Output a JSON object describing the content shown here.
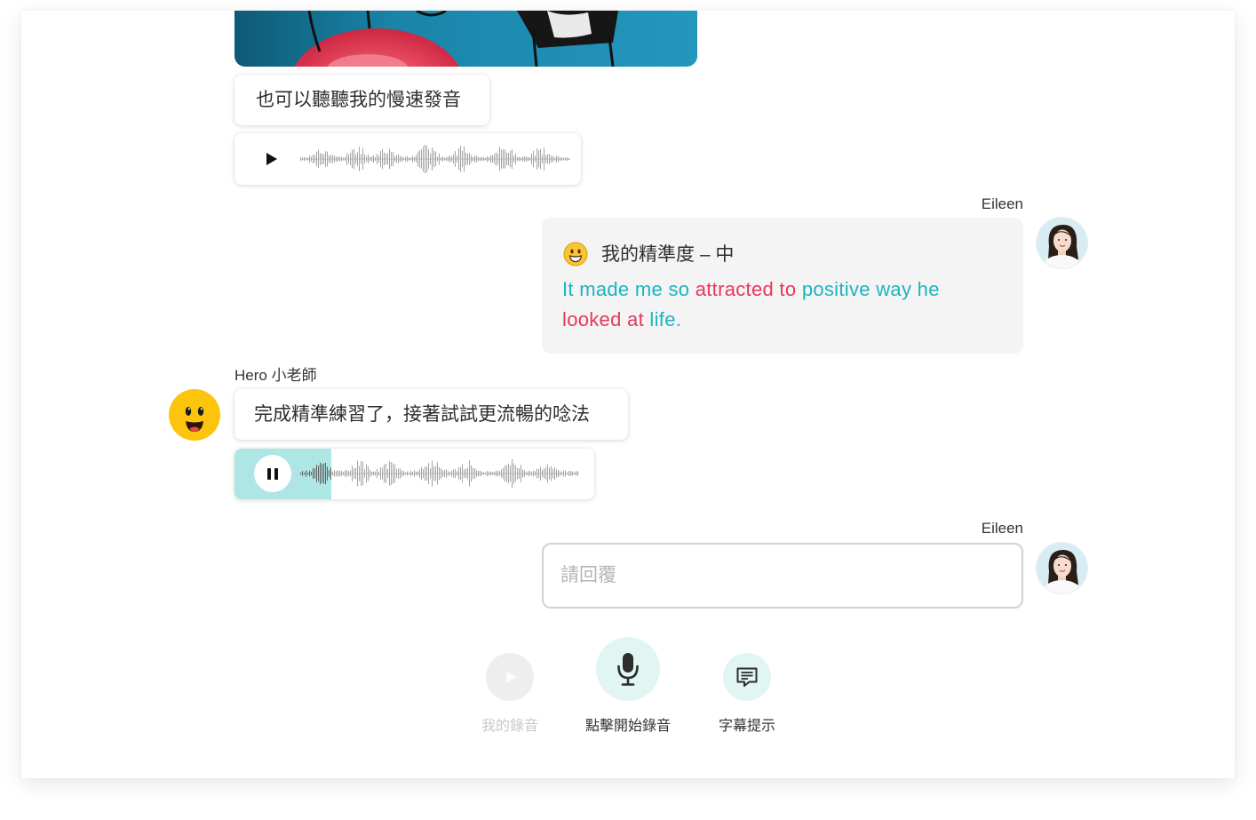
{
  "colors": {
    "correct_text": "#1cb4bf",
    "incorrect_text": "#e6375d",
    "audio_progress_fill": "#ade6e4",
    "user_bubble_bg": "#f4f4f4",
    "teacher_avatar": "#fdc40d",
    "control_active_bg": "#e1f5f3",
    "control_disabled_bg": "#eeeeee"
  },
  "thread": {
    "slow_audio_message": {
      "text": "也可以聽聽我的慢速發音",
      "audio": {
        "playing": false,
        "progress": 0
      }
    },
    "user_attempt": {
      "sender": "Eileen",
      "result_emoji": "grinning-face-icon",
      "accuracy_label": "我的精準度 – 中",
      "sentence_segments": [
        {
          "text": "It made me so",
          "correct": true
        },
        {
          "text": "attracted to",
          "correct": false
        },
        {
          "text": "positive way he",
          "correct": true
        },
        {
          "text": "looked at",
          "correct": false
        },
        {
          "text": "life.",
          "correct": true
        }
      ]
    },
    "fluency_prompt": {
      "sender": "Hero 小老師",
      "text": "完成精準練習了，接著試試更流暢的唸法",
      "audio": {
        "playing": true,
        "progress": 0.27
      }
    },
    "reply": {
      "sender": "Eileen",
      "placeholder": "請回覆",
      "value": ""
    }
  },
  "controls": [
    {
      "label": "我的錄音",
      "icon": "play-icon",
      "enabled": false
    },
    {
      "label": "點擊開始錄音",
      "icon": "microphone-icon",
      "enabled": true
    },
    {
      "label": "字幕提示",
      "icon": "subtitles-icon",
      "enabled": true
    }
  ]
}
